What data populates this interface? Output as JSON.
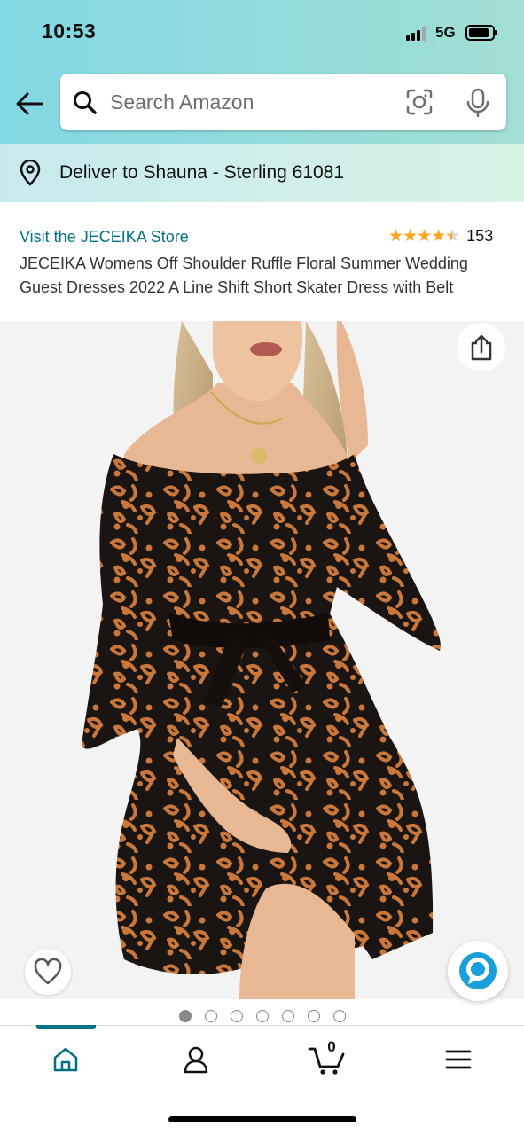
{
  "status_bar": {
    "time": "10:53",
    "network": "5G"
  },
  "search": {
    "placeholder": "Search Amazon"
  },
  "delivery": {
    "text": "Deliver to Shauna - Sterling 61081"
  },
  "product": {
    "store_link": "Visit the JECEIKA Store",
    "rating": 4.5,
    "rating_count": "153",
    "title": "JECEIKA Womens Off Shoulder Ruffle Floral Summer Wedding Guest Dresses 2022 A Line Shift Short Skater Dress with Belt"
  },
  "gallery": {
    "image_count": 7,
    "active_index": 0
  },
  "cart": {
    "count": "0"
  },
  "colors": {
    "accent": "#007185",
    "star": "#ffa41c",
    "header_gradient_start": "#82d8e3",
    "header_gradient_end": "#a2dfd4",
    "dress_black": "#1a1412",
    "floral_orange": "#c9773a"
  },
  "icons": {
    "back": "arrow-left-icon",
    "search": "search-icon",
    "lens": "camera-lens-icon",
    "mic": "microphone-icon",
    "location": "location-pin-icon",
    "share": "share-icon",
    "wishlist": "heart-icon",
    "alexa": "alexa-icon",
    "home": "home-icon",
    "account": "account-icon",
    "cart": "cart-icon",
    "menu": "menu-icon"
  }
}
